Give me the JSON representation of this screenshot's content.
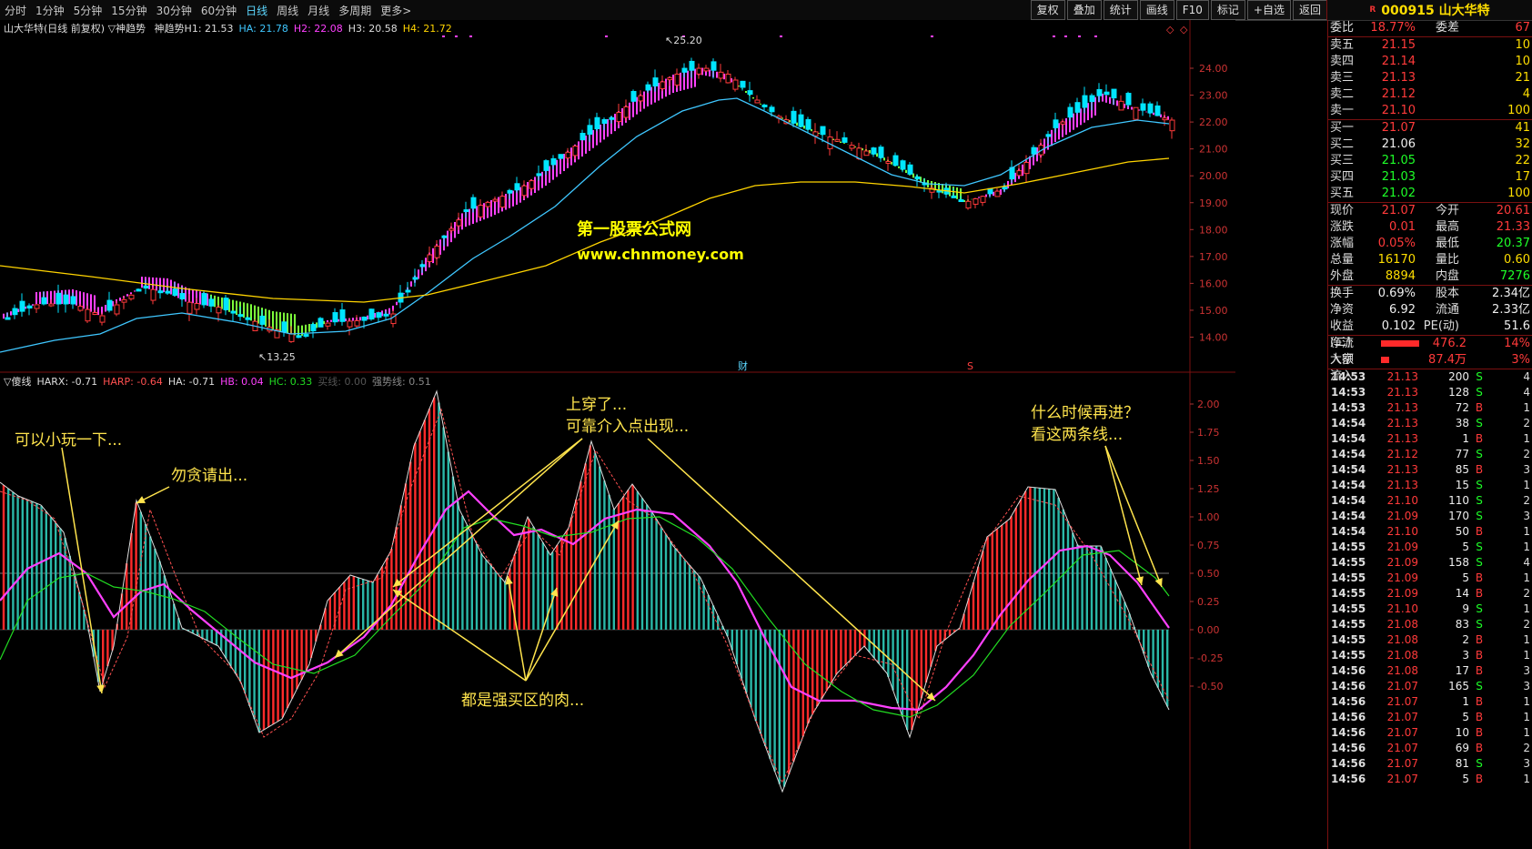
{
  "toolbar": {
    "timeframes": [
      "分时",
      "1分钟",
      "5分钟",
      "15分钟",
      "30分钟",
      "60分钟",
      "日线",
      "周线",
      "月线",
      "多周期",
      "更多>"
    ],
    "active_index": 6,
    "tools": [
      "复权",
      "叠加",
      "统计",
      "画线",
      "F10",
      "标记",
      "+自选",
      "返回"
    ]
  },
  "stock": {
    "marker": "R",
    "code_name": "000915 山大华特"
  },
  "main_legend": {
    "title": "山大华特(日线 前复权) ▽神趋势",
    "items": [
      {
        "text": "神趋势H1: 21.53",
        "color": "#dddddd"
      },
      {
        "text": "HA: 21.78",
        "color": "#3fc7ff"
      },
      {
        "text": "H2: 22.08",
        "color": "#ff40ff"
      },
      {
        "text": "H3: 20.58",
        "color": "#dddddd"
      },
      {
        "text": "H4: 21.72",
        "color": "#ffd400"
      }
    ]
  },
  "osc_legend": {
    "items": [
      {
        "text": "▽傻线",
        "color": "#dddddd"
      },
      {
        "text": "HARX: -0.71",
        "color": "#dddddd"
      },
      {
        "text": "HARP: -0.64",
        "color": "#ff5050"
      },
      {
        "text": "HA: -0.71",
        "color": "#dddddd"
      },
      {
        "text": "HB: 0.04",
        "color": "#ff40ff"
      },
      {
        "text": "HC: 0.33",
        "color": "#22dd22"
      },
      {
        "text": "买线: 0.00",
        "color": "#555555"
      },
      {
        "text": "强势线: 0.51",
        "color": "#888888"
      }
    ]
  },
  "watermark": {
    "line1": "第一股票公式网",
    "line2": "www.chnmoney.com"
  },
  "price_labels": {
    "high": "25.20",
    "low": "13.25",
    "cai": "财",
    "s": "S"
  },
  "main_axis": [
    "24.00",
    "23.00",
    "22.00",
    "21.00",
    "20.00",
    "19.00",
    "18.00",
    "17.00",
    "16.00",
    "15.00",
    "14.00"
  ],
  "osc_axis": [
    "2.00",
    "1.75",
    "1.50",
    "1.25",
    "1.00",
    "0.75",
    "0.50",
    "0.25",
    "0.00",
    "-0.25",
    "-0.50"
  ],
  "annotations": {
    "a1": "可以小玩一下...",
    "a2": "勿贪请出...",
    "a3_1": "上穿了...",
    "a3_2": "可靠介入点出现...",
    "a4_1": "什么时候再进？",
    "a4_2": "看这两条线...",
    "a5": "都是强买区的肉..."
  },
  "quote": {
    "webi": {
      "label": "委比",
      "value": "18.77%",
      "label2": "委差",
      "value2": "67"
    },
    "asks": [
      {
        "label": "卖五",
        "price": "21.15",
        "vol": "10"
      },
      {
        "label": "卖四",
        "price": "21.14",
        "vol": "10"
      },
      {
        "label": "卖三",
        "price": "21.13",
        "vol": "21"
      },
      {
        "label": "卖二",
        "price": "21.12",
        "vol": "4"
      },
      {
        "label": "卖一",
        "price": "21.10",
        "vol": "100"
      }
    ],
    "bids": [
      {
        "label": "买一",
        "price": "21.07",
        "vol": "41"
      },
      {
        "label": "买二",
        "price": "21.06",
        "vol": "32"
      },
      {
        "label": "买三",
        "price": "21.05",
        "vol": "22"
      },
      {
        "label": "买四",
        "price": "21.03",
        "vol": "17"
      },
      {
        "label": "买五",
        "price": "21.02",
        "vol": "100"
      }
    ],
    "stats1": [
      {
        "l1": "现价",
        "v1": "21.07",
        "l2": "今开",
        "v2": "20.61"
      },
      {
        "l1": "涨跌",
        "v1": "0.01",
        "l2": "最高",
        "v2": "21.33"
      },
      {
        "l1": "涨幅",
        "v1": "0.05%",
        "l2": "最低",
        "v2": "20.37"
      },
      {
        "l1": "总量",
        "v1": "16170",
        "l2": "量比",
        "v2": "0.60"
      },
      {
        "l1": "外盘",
        "v1": "8894",
        "l2": "内盘",
        "v2": "7276"
      }
    ],
    "stats2": [
      {
        "l1": "换手",
        "v1": "0.69%",
        "l2": "股本",
        "v2": "2.34亿"
      },
      {
        "l1": "净资",
        "v1": "6.92",
        "l2": "流通",
        "v2": "2.33亿"
      },
      {
        "l1": "收益(二)",
        "v1": "0.102",
        "l2": "PE(动)",
        "v2": "51.6"
      }
    ],
    "flow": [
      {
        "label": "净流入额",
        "value": "476.2万",
        "pct": "14%",
        "bar_pct": 14
      },
      {
        "label": "大宗流入",
        "value": "87.4万",
        "pct": "3%",
        "bar_pct": 3
      }
    ]
  },
  "ticks": [
    {
      "t": "14:53",
      "p": "21.13",
      "v": "200",
      "f": "S",
      "n": "4"
    },
    {
      "t": "14:53",
      "p": "21.13",
      "v": "128",
      "f": "S",
      "n": "4"
    },
    {
      "t": "14:53",
      "p": "21.13",
      "v": "72",
      "f": "B",
      "n": "1"
    },
    {
      "t": "14:54",
      "p": "21.13",
      "v": "38",
      "f": "S",
      "n": "2"
    },
    {
      "t": "14:54",
      "p": "21.13",
      "v": "1",
      "f": "B",
      "n": "1"
    },
    {
      "t": "14:54",
      "p": "21.12",
      "v": "77",
      "f": "S",
      "n": "2"
    },
    {
      "t": "14:54",
      "p": "21.13",
      "v": "85",
      "f": "B",
      "n": "3"
    },
    {
      "t": "14:54",
      "p": "21.13",
      "v": "15",
      "f": "S",
      "n": "1"
    },
    {
      "t": "14:54",
      "p": "21.10",
      "v": "110",
      "f": "S",
      "n": "2"
    },
    {
      "t": "14:54",
      "p": "21.09",
      "v": "170",
      "f": "S",
      "n": "3"
    },
    {
      "t": "14:54",
      "p": "21.10",
      "v": "50",
      "f": "B",
      "n": "1"
    },
    {
      "t": "14:55",
      "p": "21.09",
      "v": "5",
      "f": "S",
      "n": "1"
    },
    {
      "t": "14:55",
      "p": "21.09",
      "v": "158",
      "f": "S",
      "n": "4"
    },
    {
      "t": "14:55",
      "p": "21.09",
      "v": "5",
      "f": "B",
      "n": "1"
    },
    {
      "t": "14:55",
      "p": "21.09",
      "v": "14",
      "f": "B",
      "n": "2"
    },
    {
      "t": "14:55",
      "p": "21.10",
      "v": "9",
      "f": "S",
      "n": "1"
    },
    {
      "t": "14:55",
      "p": "21.08",
      "v": "83",
      "f": "S",
      "n": "2"
    },
    {
      "t": "14:55",
      "p": "21.08",
      "v": "2",
      "f": "B",
      "n": "1"
    },
    {
      "t": "14:55",
      "p": "21.08",
      "v": "3",
      "f": "B",
      "n": "1"
    },
    {
      "t": "14:56",
      "p": "21.08",
      "v": "17",
      "f": "B",
      "n": "3"
    },
    {
      "t": "14:56",
      "p": "21.07",
      "v": "165",
      "f": "S",
      "n": "3"
    },
    {
      "t": "14:56",
      "p": "21.07",
      "v": "1",
      "f": "B",
      "n": "1"
    },
    {
      "t": "14:56",
      "p": "21.07",
      "v": "5",
      "f": "B",
      "n": "1"
    },
    {
      "t": "14:56",
      "p": "21.07",
      "v": "10",
      "f": "B",
      "n": "1"
    },
    {
      "t": "14:56",
      "p": "21.07",
      "v": "69",
      "f": "B",
      "n": "2"
    },
    {
      "t": "14:56",
      "p": "21.07",
      "v": "81",
      "f": "S",
      "n": "3"
    },
    {
      "t": "14:56",
      "p": "21.07",
      "v": "5",
      "f": "B",
      "n": "1"
    }
  ],
  "colors": {
    "up": "#ff3a3a",
    "down": "#00e5ff",
    "trend_up": "#ff40ff",
    "trend_down": "#7cff3a",
    "ma_blue": "#3fc7ff",
    "ma_yellow": "#ffd400",
    "osc_red": "#ff2a2a",
    "osc_teal": "#2ab8a8",
    "buy": "#ff3a3a",
    "sell": "#1eff28"
  }
}
